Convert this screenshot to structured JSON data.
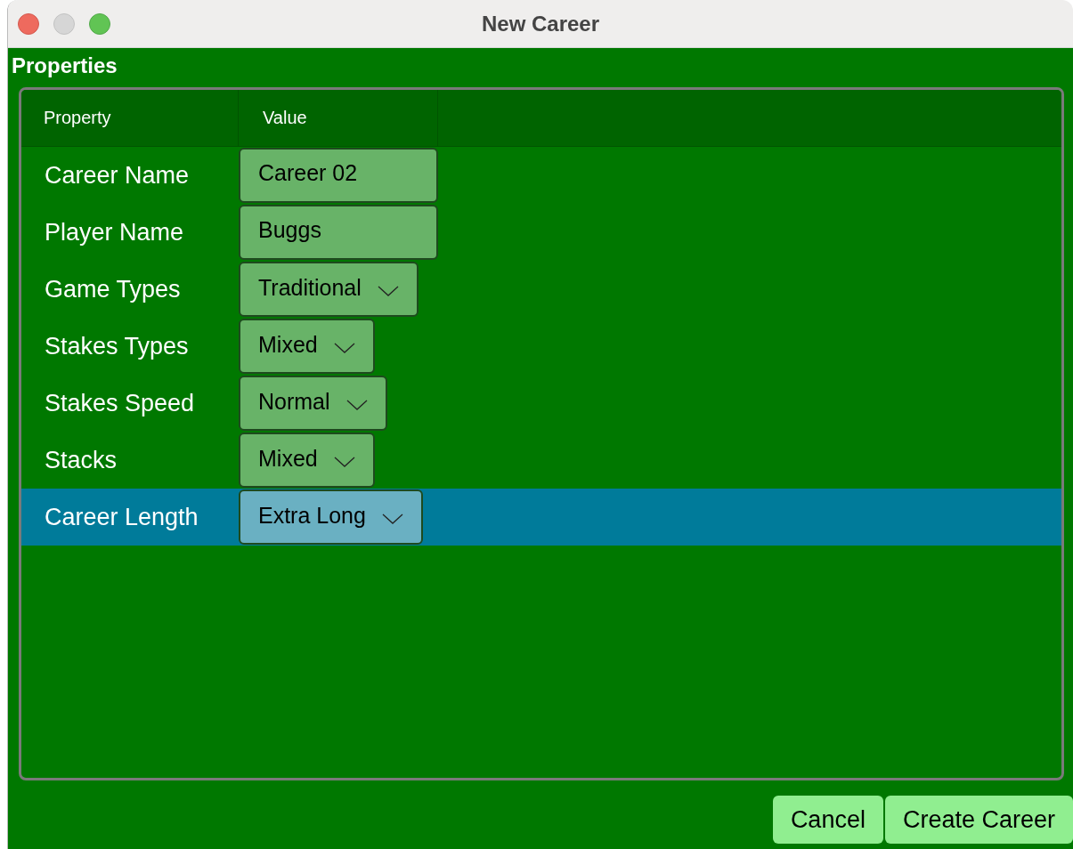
{
  "window": {
    "title": "New Career"
  },
  "section_title": "Properties",
  "table": {
    "columns": [
      "Property",
      "Value"
    ],
    "rows": [
      {
        "property": "Career Name",
        "kind": "text",
        "value": "Career 02",
        "selected": false
      },
      {
        "property": "Player Name",
        "kind": "text",
        "value": "Buggs",
        "selected": false
      },
      {
        "property": "Game Types",
        "kind": "select",
        "value": "Traditional",
        "selected": false
      },
      {
        "property": "Stakes Types",
        "kind": "select",
        "value": "Mixed",
        "selected": false
      },
      {
        "property": "Stakes Speed",
        "kind": "select",
        "value": "Normal",
        "selected": false
      },
      {
        "property": "Stacks",
        "kind": "select",
        "value": "Mixed",
        "selected": false
      },
      {
        "property": "Career Length",
        "kind": "select",
        "value": "Extra Long",
        "selected": true
      }
    ]
  },
  "buttons": [
    "Cancel",
    "Create Career"
  ]
}
